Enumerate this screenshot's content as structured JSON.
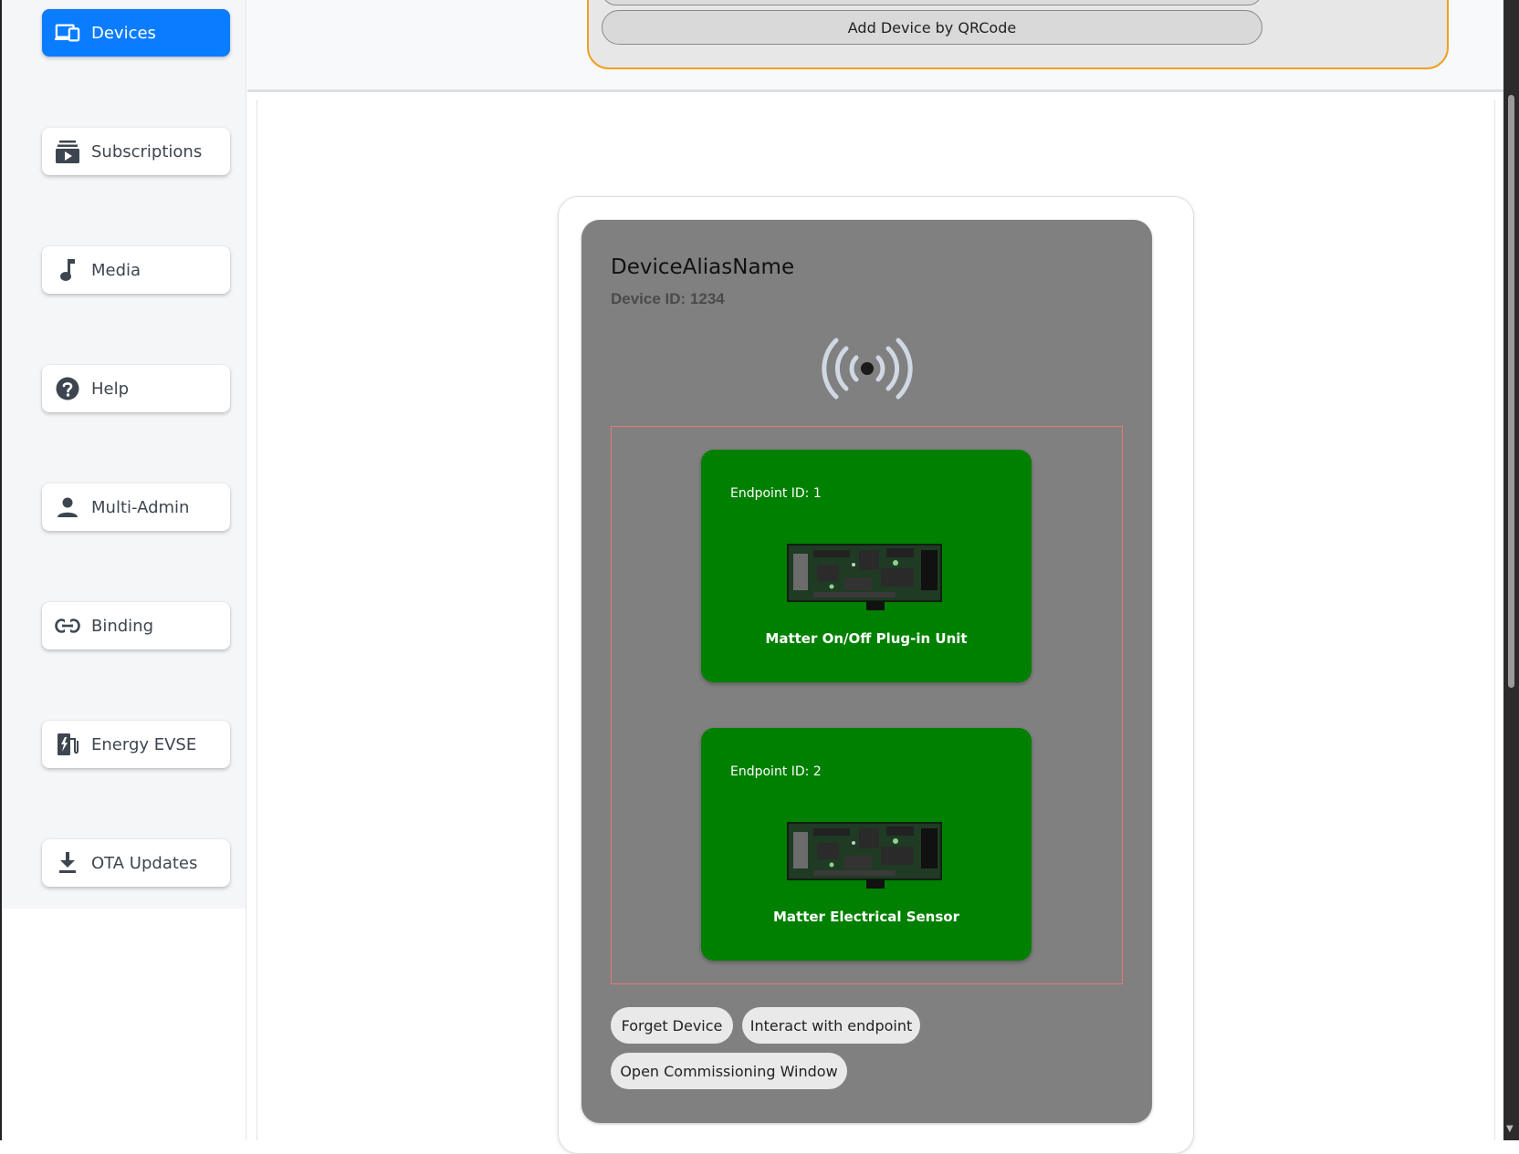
{
  "sidebar": {
    "items": [
      {
        "label": "Devices",
        "icon": "devices-icon",
        "active": true
      },
      {
        "label": "Subscriptions",
        "icon": "subscriptions-icon"
      },
      {
        "label": "Media",
        "icon": "music-note-icon"
      },
      {
        "label": "Help",
        "icon": "help-icon"
      },
      {
        "label": "Multi-Admin",
        "icon": "person-icon"
      },
      {
        "label": "Binding",
        "icon": "link-icon"
      },
      {
        "label": "Energy EVSE",
        "icon": "ev-charger-icon"
      },
      {
        "label": "OTA Updates",
        "icon": "download-icon"
      }
    ]
  },
  "toolbar": {
    "qr_button": "Add Device by QRCode"
  },
  "device": {
    "alias": "DeviceAliasName",
    "id_text": "Device ID: 1234",
    "status_icon": "wireless-signal-icon",
    "endpoints": [
      {
        "id_text": "Endpoint ID: 1",
        "name": "Matter On/Off Plug-in Unit",
        "image": "circuit-board-image"
      },
      {
        "id_text": "Endpoint ID: 2",
        "name": "Matter Electrical Sensor",
        "image": "circuit-board-image"
      }
    ],
    "actions": {
      "forget": "Forget Device",
      "interact": "Interact with endpoint",
      "open_window": "Open Commissioning Window"
    }
  },
  "colors": {
    "accent": "#0a7cff",
    "panel_border": "#f0a020",
    "endpoint_card": "#008000",
    "device_card": "#808080",
    "endpoint_border": "#e8787a"
  }
}
